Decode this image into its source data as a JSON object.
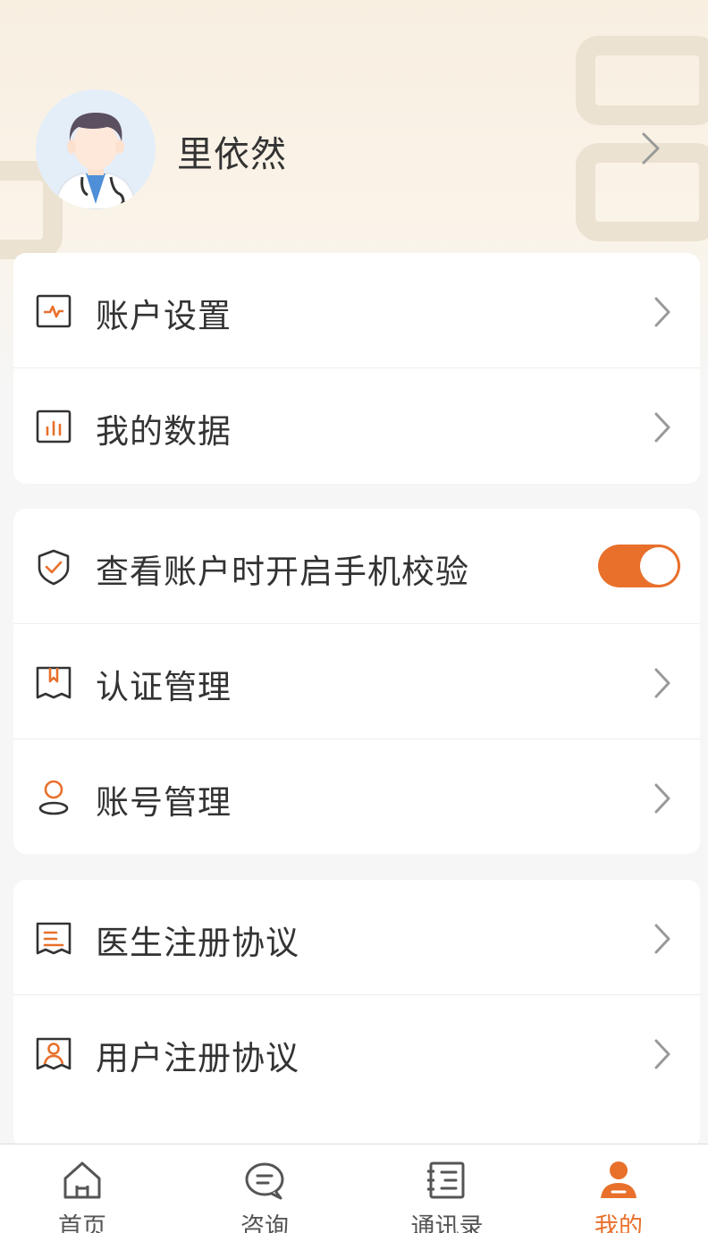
{
  "profile": {
    "name": "里依然"
  },
  "menu_group_1": [
    {
      "label": "账户设置",
      "icon": "chart-line-icon"
    },
    {
      "label": "我的数据",
      "icon": "bar-chart-icon"
    }
  ],
  "menu_group_2": {
    "verify_label": "查看账户时开启手机校验",
    "verify_enabled": true,
    "items": [
      {
        "label": "认证管理",
        "icon": "bookmark-icon"
      },
      {
        "label": "账号管理",
        "icon": "user-icon"
      }
    ]
  },
  "menu_group_3": [
    {
      "label": "医生注册协议",
      "icon": "document-icon"
    },
    {
      "label": "用户注册协议",
      "icon": "user-document-icon"
    }
  ],
  "tabbar": [
    {
      "label": "首页",
      "icon": "home-icon",
      "active": false
    },
    {
      "label": "咨询",
      "icon": "chat-icon",
      "active": false
    },
    {
      "label": "通讯录",
      "icon": "contacts-icon",
      "active": false
    },
    {
      "label": "我的",
      "icon": "profile-icon",
      "active": true
    }
  ],
  "colors": {
    "accent": "#e8702b",
    "text": "#333333",
    "chevron": "#999999"
  }
}
